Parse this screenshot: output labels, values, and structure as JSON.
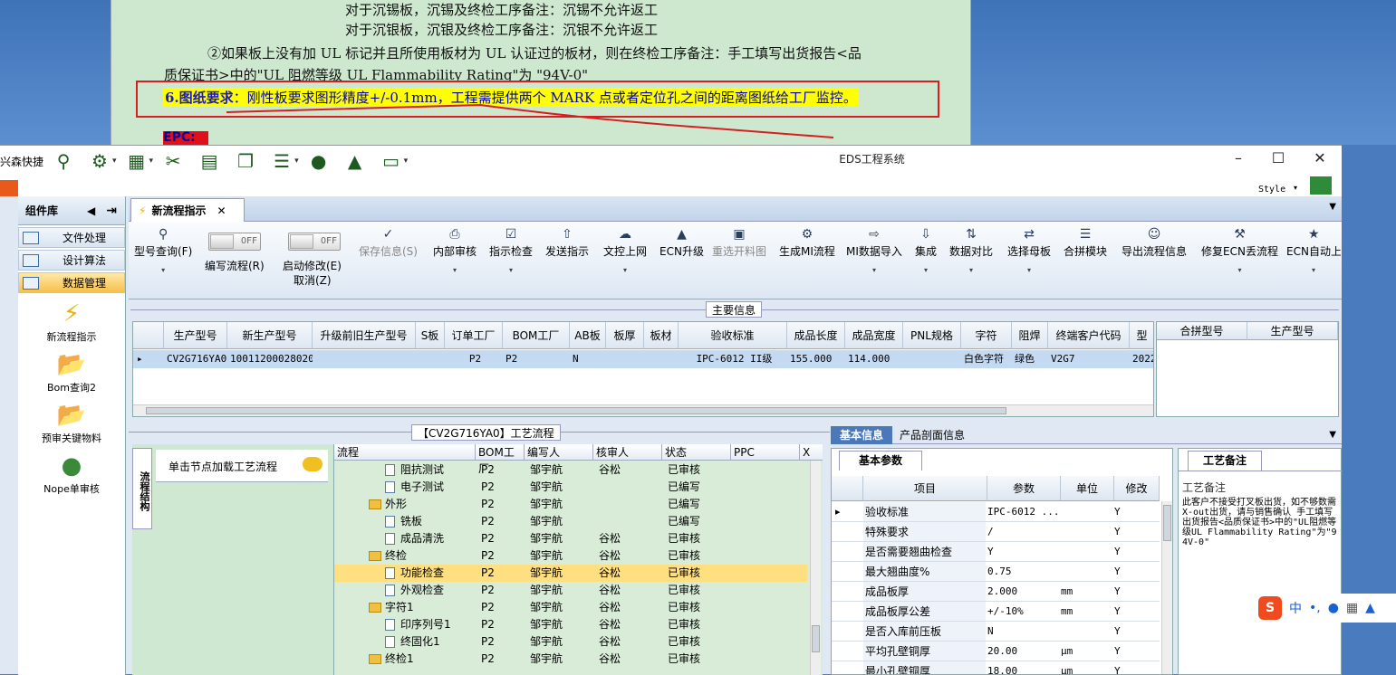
{
  "doc": {
    "line1": "对于沉锡板，沉锡及终检工序备注：沉锡不允许返工",
    "line2": "对于沉银板，沉银及终检工序备注：沉银不允许返工",
    "line3": "②如果板上没有加 UL 标记并且所使用板材为 UL 认证过的板材，则在终检工序备注：手工填写出货报告<品",
    "line4": "质保证书>中的\"UL 阻燃等级 UL Flammability Rating\"为 \"94V-0\"",
    "hl_bold": "6.图纸要求",
    "hl_rest": "：刚性板要求图形精度+/-0.1mm，工程需提供两个 MARK 点或者定位孔之间的距离图纸给工厂监控。",
    "epc": "EPC:"
  },
  "app": {
    "title": "EDS工程系统",
    "quick_label": "兴森快捷",
    "style_label": "Style",
    "quick_icons": [
      "search-icon",
      "settings-icon",
      "grid-icon",
      "scissors-icon",
      "film-icon",
      "copy-icon",
      "list-icon",
      "user-icon",
      "chart-icon",
      "monitor-icon"
    ]
  },
  "left": {
    "header": "组件库",
    "items": [
      "文件处理",
      "设计算法",
      "数据管理"
    ],
    "nav": [
      "新流程指示",
      "Bom查询2",
      "预审关键物料",
      "Nope单审核"
    ]
  },
  "tab": {
    "label": "新流程指示"
  },
  "ribbon": {
    "query": "型号查询(F)",
    "edit_flow": "编写流程(R)",
    "auto_modify": "启动修改(E)",
    "cancel": "取消(Z)",
    "toggle_off": "OFF",
    "buttons": [
      "保存信息(S)",
      "内部审核",
      "指示检查",
      "发送指示",
      "文控上网",
      "ECN升级",
      "重选开料图",
      "生成MI流程",
      "MI数据导入",
      "集成",
      "数据对比",
      "选择母板",
      "合拼模块",
      "导出流程信息",
      "修复ECN丢流程",
      "ECN自动上网"
    ]
  },
  "main": {
    "label": "主要信息",
    "columns": [
      "生产型号",
      "新生产型号",
      "升级前旧生产型号",
      "S板",
      "订单工厂",
      "BOM工厂",
      "AB板",
      "板厚",
      "板材",
      "验收标准",
      "成品长度",
      "成品宽度",
      "PNL规格",
      "字符",
      "阻焊",
      "终端客户代码",
      "型"
    ],
    "row": [
      "CV2G716YA0",
      "10011200028020",
      "",
      "",
      "P2",
      "P2",
      "N",
      "",
      "",
      "IPC-6012 II级",
      "155.000",
      "114.000",
      "",
      "白色字符",
      "绿色",
      "V2G7",
      "2022/"
    ],
    "side_columns": [
      "合拼型号",
      "生产型号"
    ]
  },
  "flow": {
    "label": "【CV2G716YA0】工艺流程",
    "vtab": "流程结构",
    "tip": "单击节点加载工艺流程",
    "columns": [
      "流程",
      "BOM工厂",
      "编写人",
      "核审人",
      "状态",
      "PPC"
    ],
    "rows": [
      {
        "name": "阻抗测试",
        "type": "page",
        "bom": "P2",
        "writer": "邹宇航",
        "checker": "谷松",
        "status": "已审核"
      },
      {
        "name": "电子测试",
        "type": "page",
        "bom": "P2",
        "writer": "邹宇航",
        "checker": "",
        "status": "已编写"
      },
      {
        "name": "外形",
        "type": "folder",
        "bom": "P2",
        "writer": "邹宇航",
        "checker": "",
        "status": "已编写"
      },
      {
        "name": "铣板",
        "type": "page",
        "bom": "P2",
        "writer": "邹宇航",
        "checker": "",
        "status": "已编写"
      },
      {
        "name": "成品清洗",
        "type": "page",
        "bom": "P2",
        "writer": "邹宇航",
        "checker": "谷松",
        "status": "已审核"
      },
      {
        "name": "终检",
        "type": "folder",
        "bom": "P2",
        "writer": "邹宇航",
        "checker": "谷松",
        "status": "已审核"
      },
      {
        "name": "功能检查",
        "type": "page",
        "bom": "P2",
        "writer": "邹宇航",
        "checker": "谷松",
        "status": "已审核"
      },
      {
        "name": "外观检查",
        "type": "page",
        "bom": "P2",
        "writer": "邹宇航",
        "checker": "谷松",
        "status": "已审核"
      },
      {
        "name": "字符1",
        "type": "folder",
        "bom": "P2",
        "writer": "邹宇航",
        "checker": "谷松",
        "status": "已审核"
      },
      {
        "name": "印序列号1",
        "type": "page",
        "bom": "P2",
        "writer": "邹宇航",
        "checker": "谷松",
        "status": "已审核"
      },
      {
        "name": "终固化1",
        "type": "page",
        "bom": "P2",
        "writer": "邹宇航",
        "checker": "谷松",
        "status": "已审核"
      },
      {
        "name": "终检1",
        "type": "folder",
        "bom": "P2",
        "writer": "邹宇航",
        "checker": "谷松",
        "status": "已审核"
      }
    ]
  },
  "right": {
    "tab1": "基本信息",
    "tab2": "产品剖面信息",
    "param_tab": "基本参数",
    "columns": [
      "项目",
      "参数",
      "单位",
      "修改"
    ],
    "rows": [
      {
        "k": "验收标准",
        "v": "IPC-6012 ...",
        "u": "",
        "m": "Y"
      },
      {
        "k": "特殊要求",
        "v": "/",
        "u": "",
        "m": "Y"
      },
      {
        "k": "是否需要翘曲检查",
        "v": "Y",
        "u": "",
        "m": "Y"
      },
      {
        "k": "最大翘曲度%",
        "v": "0.75",
        "u": "",
        "m": "Y"
      },
      {
        "k": "成品板厚",
        "v": "2.000",
        "u": "mm",
        "m": "Y"
      },
      {
        "k": "成品板厚公差",
        "v": "+/-10%",
        "u": "mm",
        "m": "Y"
      },
      {
        "k": "是否入库前压板",
        "v": "N",
        "u": "",
        "m": "Y"
      },
      {
        "k": "平均孔壁铜厚",
        "v": "20.00",
        "u": "μm",
        "m": "Y"
      },
      {
        "k": "最小孔壁铜厚",
        "v": "18.00",
        "u": "μm",
        "m": "Y"
      }
    ],
    "notes_tab": "工艺备注",
    "notes_label": "工艺备注",
    "notes_text": "此客户不接受打叉板出货，如不够数需X-out出货，请与销售确认 手工填写出货报告<品质保证书>中的\"UL阻燃等级UL Flammability Rating\"为\"94V-0\""
  },
  "ime": {
    "label": "中"
  }
}
